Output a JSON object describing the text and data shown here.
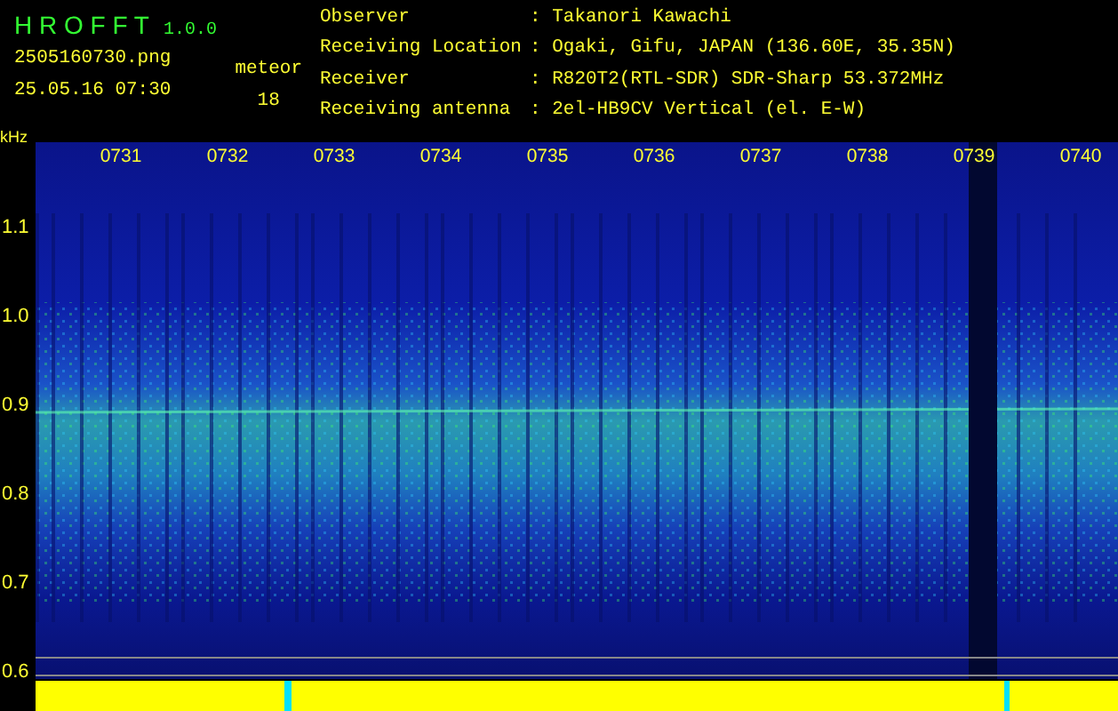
{
  "app": {
    "name": "H R O F F T",
    "version": "1.0.0"
  },
  "file": "2505160730.png",
  "datetime": "25.05.16 07:30",
  "meteor": {
    "label": "meteor",
    "count": "18"
  },
  "info": [
    {
      "label": "Observer",
      "value": ": Takanori Kawachi"
    },
    {
      "label": "Receiving Location",
      "value": ": Ogaki, Gifu, JAPAN (136.60E, 35.35N)"
    },
    {
      "label": "Receiver",
      "value": ": R820T2(RTL-SDR) SDR-Sharp 53.372MHz"
    },
    {
      "label": "Receiving antenna",
      "value": ": 2el-HB9CV Vertical (el. E-W)"
    }
  ],
  "spectrogram": {
    "unit": "kHz",
    "time_labels": [
      "0731",
      "0732",
      "0733",
      "0734",
      "0735",
      "0736",
      "0737",
      "0738",
      "0739",
      "0740"
    ],
    "freq_labels": [
      "1.1",
      "1.0",
      "0.9",
      "0.8",
      "0.7",
      "0.6"
    ]
  }
}
